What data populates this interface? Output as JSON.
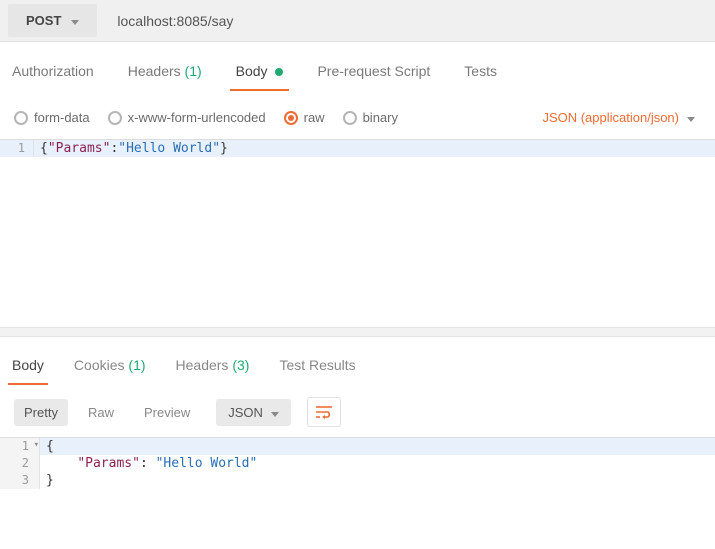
{
  "request": {
    "method": "POST",
    "url": "localhost:8085/say",
    "tabs": [
      "Authorization",
      "Headers",
      "Body",
      "Pre-request Script",
      "Tests"
    ],
    "tabs_active_index": 2,
    "headers_count": "(1)",
    "body_has_content": true,
    "body_types": [
      "form-data",
      "x-www-form-urlencoded",
      "raw",
      "binary"
    ],
    "body_type_selected_index": 2,
    "content_type_label": "JSON (application/json)",
    "body_lines": [
      {
        "n": "1",
        "segments": [
          {
            "t": "{",
            "c": "brace"
          },
          {
            "t": "\"Params\"",
            "c": "key"
          },
          {
            "t": ":",
            "c": "brace"
          },
          {
            "t": "\"Hello World\"",
            "c": "str"
          },
          {
            "t": "}",
            "c": "brace"
          }
        ]
      }
    ]
  },
  "response": {
    "tabs": [
      "Body",
      "Cookies",
      "Headers",
      "Test Results"
    ],
    "tabs_active_index": 0,
    "cookies_count": "(1)",
    "headers_count": "(3)",
    "view_modes": [
      "Pretty",
      "Raw",
      "Preview"
    ],
    "view_mode_active_index": 0,
    "format_label": "JSON",
    "body_lines": [
      {
        "n": "1",
        "fold": true,
        "segments": [
          {
            "t": "{",
            "c": "brace"
          }
        ]
      },
      {
        "n": "2",
        "segments": [
          {
            "t": "    ",
            "c": "brace"
          },
          {
            "t": "\"Params\"",
            "c": "key"
          },
          {
            "t": ": ",
            "c": "brace"
          },
          {
            "t": "\"Hello World\"",
            "c": "str"
          }
        ]
      },
      {
        "n": "3",
        "segments": [
          {
            "t": "}",
            "c": "brace"
          }
        ]
      }
    ]
  }
}
